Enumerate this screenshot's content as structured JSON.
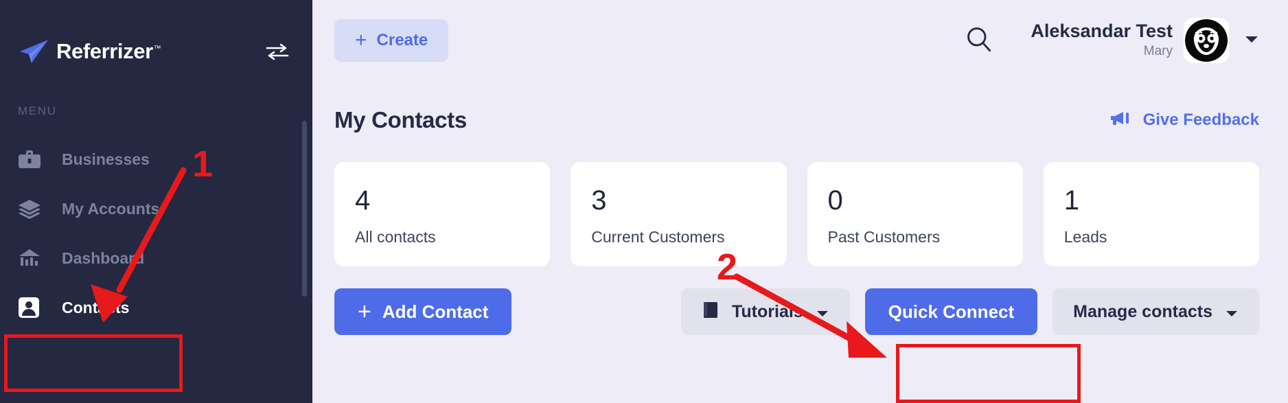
{
  "sidebar": {
    "brand": {
      "name": "Referrizer",
      "trademark": "™",
      "logo_icon": "paper-plane-logo"
    },
    "swap_icon": "swap-arrows-icon",
    "section_label": "MENU",
    "items": [
      {
        "label": "Businesses",
        "icon": "briefcase-icon",
        "active": false
      },
      {
        "label": "My Accounts",
        "icon": "layers-icon",
        "active": false
      },
      {
        "label": "Dashboard",
        "icon": "bank-chart-icon",
        "active": false
      },
      {
        "label": "Contacts",
        "icon": "contact-card-icon",
        "active": true
      }
    ]
  },
  "topbar": {
    "create_label": "Create",
    "create_plus": "+",
    "search_icon": "search-icon",
    "user": {
      "name": "Aleksandar Test",
      "subtitle": "Mary",
      "avatar_icon": "raccoon-avatar",
      "caret_icon": "chevron-down-icon"
    }
  },
  "page": {
    "title": "My Contacts",
    "feedback": {
      "label": "Give Feedback",
      "icon": "megaphone-icon"
    }
  },
  "stats": [
    {
      "value": "4",
      "label": "All contacts"
    },
    {
      "value": "3",
      "label": "Current Customers"
    },
    {
      "value": "0",
      "label": "Past Customers"
    },
    {
      "value": "1",
      "label": "Leads"
    }
  ],
  "actions": {
    "add_contact": {
      "label": "Add Contact",
      "plus": "+"
    },
    "tutorials": {
      "label": "Tutorials",
      "icon": "book-icon",
      "caret": "chevron-down-icon"
    },
    "quick_connect": {
      "label": "Quick Connect"
    },
    "manage_contacts": {
      "label": "Manage contacts",
      "caret": "chevron-down-icon"
    }
  },
  "annotations": {
    "color": "#e8191b",
    "steps": [
      {
        "number": "1",
        "target": "sidebar-item-contacts"
      },
      {
        "number": "2",
        "target": "quick-connect-button"
      }
    ]
  },
  "colors": {
    "sidebar_bg": "#242841",
    "page_bg": "#edecf7",
    "accent_blue": "#4f6ce8",
    "accent_blue_soft": "#d7dcf7",
    "annotation_red": "#e8191b",
    "card_bg": "#ffffff"
  }
}
